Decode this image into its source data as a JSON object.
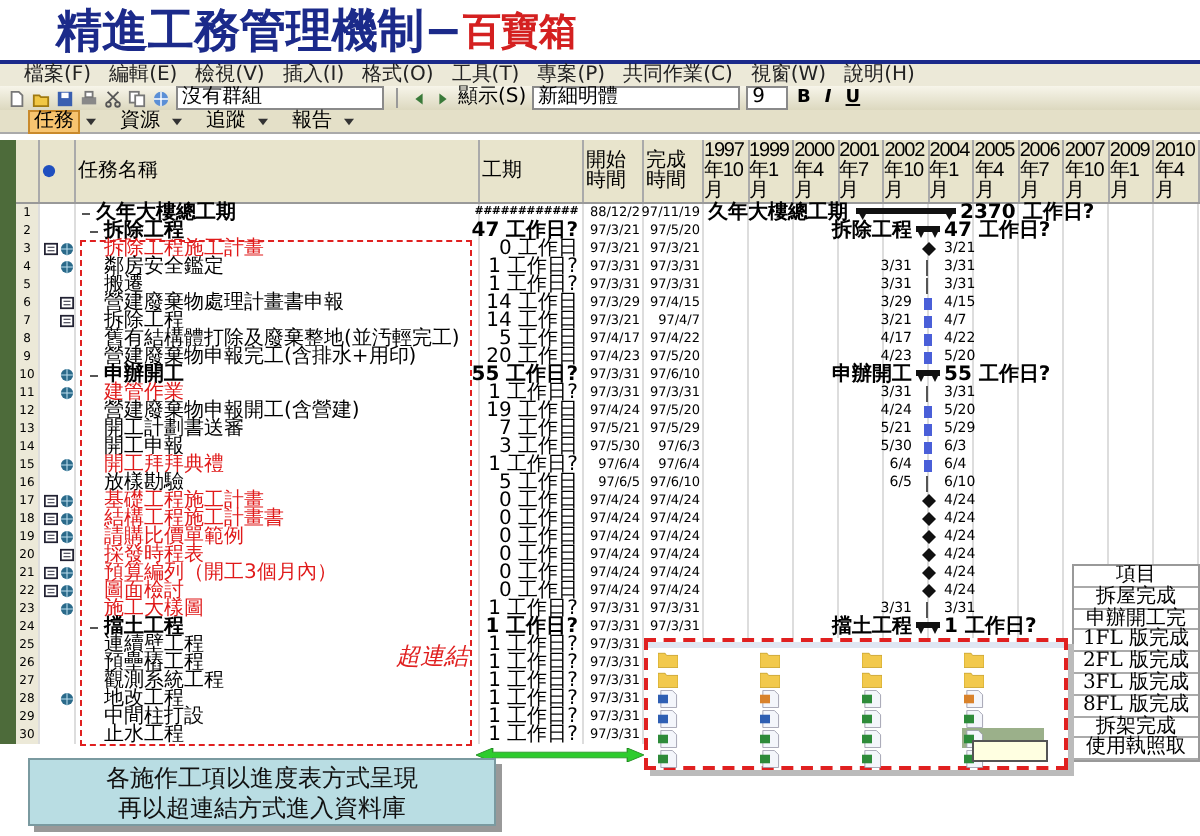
{
  "title": {
    "main": "精進工務管理機制−",
    "accent": "百寶箱"
  },
  "menu": [
    "檔案(F)",
    "編輯(E)",
    "檢視(V)",
    "插入(I)",
    "格式(O)",
    "工具(T)",
    "專案(P)",
    "共同作業(C)",
    "視窗(W)",
    "說明(H)"
  ],
  "toolbar": {
    "group": "沒有群組",
    "show": "顯示(S)",
    "font": "新細明體",
    "size": "9",
    "styles": [
      "B",
      "I",
      "U"
    ]
  },
  "guide_tabs": [
    {
      "label": "任務",
      "selected": true
    },
    {
      "label": "資源",
      "selected": false
    },
    {
      "label": "追蹤",
      "selected": false
    },
    {
      "label": "報告",
      "selected": false
    }
  ],
  "table": {
    "columns": [
      "任務名稱",
      "工期",
      "開始時間",
      "完成時間"
    ],
    "timescale": [
      "1997年10月",
      "1999年1月",
      "2000年4月",
      "2001年7月",
      "2002年10月",
      "2004年1月",
      "2005年4月",
      "2006年7月",
      "2007年10月",
      "2009年1月",
      "2010年4月"
    ],
    "rows": [
      {
        "num": "1",
        "kind": "project",
        "name": "久年大樓總工期",
        "expanded": true,
        "hyperlink": false,
        "note": false,
        "link": false,
        "duration": "############",
        "start": "88/12/2",
        "finish": "97/11/19",
        "gantt": {
          "kind": "project",
          "left": "久年大樓總工期",
          "right": "2370 工作日?"
        }
      },
      {
        "num": "2",
        "kind": "summary",
        "name": "拆除工程",
        "expanded": true,
        "hyperlink": false,
        "note": false,
        "link": false,
        "duration": "47 工作日?",
        "start": "97/3/21",
        "finish": "97/5/20",
        "gantt": {
          "kind": "summary",
          "left": "拆除工程",
          "right": "47 工作日?"
        }
      },
      {
        "num": "3",
        "kind": "task",
        "name": "拆除工程施工計畫",
        "hyperlink": true,
        "note": true,
        "link": true,
        "duration": "0 工作日",
        "start": "97/3/21",
        "finish": "97/3/21",
        "gantt": {
          "kind": "milestone",
          "right": "3/21"
        }
      },
      {
        "num": "4",
        "kind": "task",
        "name": "鄰房安全鑑定",
        "hyperlink": false,
        "note": false,
        "link": true,
        "duration": "1 工作日?",
        "start": "97/3/31",
        "finish": "97/3/31",
        "gantt": {
          "kind": "tick",
          "left": "3/31",
          "right": "3/31"
        }
      },
      {
        "num": "5",
        "kind": "task",
        "name": "搬遷",
        "hyperlink": false,
        "note": false,
        "link": false,
        "duration": "1 工作日?",
        "start": "97/3/31",
        "finish": "97/3/31",
        "gantt": {
          "kind": "tick",
          "left": "3/31",
          "right": "3/31"
        }
      },
      {
        "num": "6",
        "kind": "task",
        "name": "營建廢棄物處理計畫書申報",
        "hyperlink": false,
        "note": true,
        "link": false,
        "duration": "14 工作日",
        "start": "97/3/29",
        "finish": "97/4/15",
        "gantt": {
          "kind": "bar",
          "left": "3/29",
          "right": "4/15"
        }
      },
      {
        "num": "7",
        "kind": "task",
        "name": "拆除工程",
        "hyperlink": false,
        "note": true,
        "link": false,
        "duration": "14 工作日",
        "start": "97/3/21",
        "finish": "97/4/7",
        "gantt": {
          "kind": "bar",
          "left": "3/21",
          "right": "4/7"
        }
      },
      {
        "num": "8",
        "kind": "task",
        "name": "舊有結構體打除及廢棄整地(並汚輕完工)",
        "hyperlink": false,
        "note": false,
        "link": false,
        "duration": "5 工作日",
        "start": "97/4/17",
        "finish": "97/4/22",
        "gantt": {
          "kind": "bar",
          "left": "4/17",
          "right": "4/22"
        }
      },
      {
        "num": "9",
        "kind": "task",
        "name": "營建廢棄物申報完工(含排水+用印)",
        "hyperlink": false,
        "note": false,
        "link": false,
        "duration": "20 工作日",
        "start": "97/4/23",
        "finish": "97/5/20",
        "gantt": {
          "kind": "bar",
          "left": "4/23",
          "right": "5/20"
        }
      },
      {
        "num": "10",
        "kind": "summary",
        "name": "申辦開工",
        "expanded": true,
        "hyperlink": false,
        "note": false,
        "link": true,
        "duration": "55 工作日?",
        "start": "97/3/31",
        "finish": "97/6/10",
        "gantt": {
          "kind": "summary",
          "left": "申辦開工",
          "right": "55 工作日?"
        }
      },
      {
        "num": "11",
        "kind": "task",
        "name": "建管作業",
        "hyperlink": true,
        "note": false,
        "link": true,
        "duration": "1 工作日?",
        "start": "97/3/31",
        "finish": "97/3/31",
        "gantt": {
          "kind": "tick",
          "left": "3/31",
          "right": "3/31"
        }
      },
      {
        "num": "12",
        "kind": "task",
        "name": "營建廢棄物申報開工(含營建)",
        "hyperlink": false,
        "note": false,
        "link": false,
        "duration": "19 工作日",
        "start": "97/4/24",
        "finish": "97/5/20",
        "gantt": {
          "kind": "bar",
          "left": "4/24",
          "right": "5/20"
        }
      },
      {
        "num": "13",
        "kind": "task",
        "name": "開工計劃書送審",
        "hyperlink": false,
        "note": false,
        "link": false,
        "duration": "7 工作日",
        "start": "97/5/21",
        "finish": "97/5/29",
        "gantt": {
          "kind": "bar",
          "left": "5/21",
          "right": "5/29"
        }
      },
      {
        "num": "14",
        "kind": "task",
        "name": "開工申報",
        "hyperlink": false,
        "note": false,
        "link": false,
        "duration": "3 工作日",
        "start": "97/5/30",
        "finish": "97/6/3",
        "gantt": {
          "kind": "bar",
          "left": "5/30",
          "right": "6/3"
        }
      },
      {
        "num": "15",
        "kind": "task",
        "name": "開工拜拜典禮",
        "hyperlink": true,
        "note": false,
        "link": true,
        "duration": "1 工作日?",
        "start": "97/6/4",
        "finish": "97/6/4",
        "gantt": {
          "kind": "bar",
          "left": "6/4",
          "right": "6/4"
        }
      },
      {
        "num": "16",
        "kind": "task",
        "name": "放樣勘驗",
        "hyperlink": false,
        "note": false,
        "link": false,
        "duration": "5 工作日",
        "start": "97/6/5",
        "finish": "97/6/10",
        "gantt": {
          "kind": "tick",
          "left": "6/5",
          "right": "6/10"
        }
      },
      {
        "num": "17",
        "kind": "task",
        "name": "基礎工程施工計畫",
        "hyperlink": true,
        "note": true,
        "link": true,
        "duration": "0 工作日",
        "start": "97/4/24",
        "finish": "97/4/24",
        "gantt": {
          "kind": "milestone",
          "right": "4/24"
        }
      },
      {
        "num": "18",
        "kind": "task",
        "name": "結構工程施工計畫書",
        "hyperlink": true,
        "note": true,
        "link": true,
        "duration": "0 工作日",
        "start": "97/4/24",
        "finish": "97/4/24",
        "gantt": {
          "kind": "milestone",
          "right": "4/24"
        }
      },
      {
        "num": "19",
        "kind": "task",
        "name": "請購比價單範例",
        "hyperlink": true,
        "note": true,
        "link": true,
        "duration": "0 工作日",
        "start": "97/4/24",
        "finish": "97/4/24",
        "gantt": {
          "kind": "milestone",
          "right": "4/24"
        }
      },
      {
        "num": "20",
        "kind": "task",
        "name": "採發時程表",
        "hyperlink": true,
        "note": true,
        "link": false,
        "duration": "0 工作日",
        "start": "97/4/24",
        "finish": "97/4/24",
        "gantt": {
          "kind": "milestone",
          "right": "4/24"
        }
      },
      {
        "num": "21",
        "kind": "task",
        "name": "預算編列（開工3個月內）",
        "hyperlink": true,
        "note": true,
        "link": true,
        "duration": "0 工作日",
        "start": "97/4/24",
        "finish": "97/4/24",
        "gantt": {
          "kind": "milestone",
          "right": "4/24"
        }
      },
      {
        "num": "22",
        "kind": "task",
        "name": "圖面檢討",
        "hyperlink": true,
        "note": true,
        "link": true,
        "duration": "0 工作日",
        "start": "97/4/24",
        "finish": "97/4/24",
        "gantt": {
          "kind": "milestone",
          "right": "4/24"
        }
      },
      {
        "num": "23",
        "kind": "task",
        "name": "施工大樣圖",
        "hyperlink": true,
        "note": false,
        "link": true,
        "duration": "1 工作日?",
        "start": "97/3/31",
        "finish": "97/3/31",
        "gantt": {
          "kind": "tick",
          "left": "3/31",
          "right": "3/31"
        }
      },
      {
        "num": "24",
        "kind": "summary",
        "name": "擋土工程",
        "expanded": true,
        "hyperlink": false,
        "note": false,
        "link": false,
        "duration": "1 工作日?",
        "start": "97/3/31",
        "finish": "97/3/31",
        "gantt": {
          "kind": "summary",
          "left": "擋土工程",
          "right": "1 工作日?"
        }
      },
      {
        "num": "25",
        "kind": "task",
        "name": "連續壁工程",
        "note": false,
        "link": false,
        "duration": "1 工作日?",
        "start": "97/3/31"
      },
      {
        "num": "26",
        "kind": "task",
        "name": "預壘樁工程",
        "note": false,
        "link": false,
        "duration": "1 工作日?",
        "start": "97/3/31"
      },
      {
        "num": "27",
        "kind": "task",
        "name": "觀測系統工程",
        "note": false,
        "link": false,
        "duration": "1 工作日?",
        "start": "97/3/31"
      },
      {
        "num": "28",
        "kind": "task",
        "name": "地改工程",
        "note": false,
        "link": true,
        "duration": "1 工作日?",
        "start": "97/3/31"
      },
      {
        "num": "29",
        "kind": "task",
        "name": "中間柱打設",
        "note": false,
        "link": false,
        "duration": "1 工作日?",
        "start": "97/3/31"
      },
      {
        "num": "30",
        "kind": "task",
        "name": "止水工程",
        "note": false,
        "link": false,
        "duration": "1 工作日?",
        "start": "97/3/31"
      }
    ]
  },
  "milestone_table": [
    "項目",
    "拆屋完成",
    "申辦開工完",
    "1FL 版完成",
    "2FL 版完成",
    "3FL 版完成",
    "8FL 版完成",
    "拆架完成",
    "使用執照取"
  ],
  "hyperlink_note": "超連結",
  "file_window": {
    "items": [
      {
        "kind": "folder",
        "selected": false
      },
      {
        "kind": "folder",
        "selected": false
      },
      {
        "kind": "folder",
        "selected": false
      },
      {
        "kind": "folder",
        "selected": false
      },
      {
        "kind": "folder",
        "selected": false
      },
      {
        "kind": "folder",
        "selected": false
      },
      {
        "kind": "folder",
        "selected": false
      },
      {
        "kind": "folder",
        "selected": false
      },
      {
        "kind": "word",
        "selected": false
      },
      {
        "kind": "image",
        "selected": false
      },
      {
        "kind": "excel",
        "selected": false
      },
      {
        "kind": "image",
        "selected": false
      },
      {
        "kind": "word",
        "selected": false
      },
      {
        "kind": "word",
        "selected": false
      },
      {
        "kind": "excel",
        "selected": false
      },
      {
        "kind": "excel",
        "selected": false
      },
      {
        "kind": "excel",
        "selected": false
      },
      {
        "kind": "excel",
        "selected": false
      },
      {
        "kind": "excel",
        "selected": false
      },
      {
        "kind": "excel",
        "selected": true
      },
      {
        "kind": "excel",
        "selected": false
      },
      {
        "kind": "excel",
        "selected": false
      },
      {
        "kind": "excel",
        "selected": false
      },
      {
        "kind": "excel",
        "selected": false
      }
    ]
  },
  "callout": [
    "各施作工項以進度表方式呈現",
    "再以超連結方式進入資料庫"
  ]
}
